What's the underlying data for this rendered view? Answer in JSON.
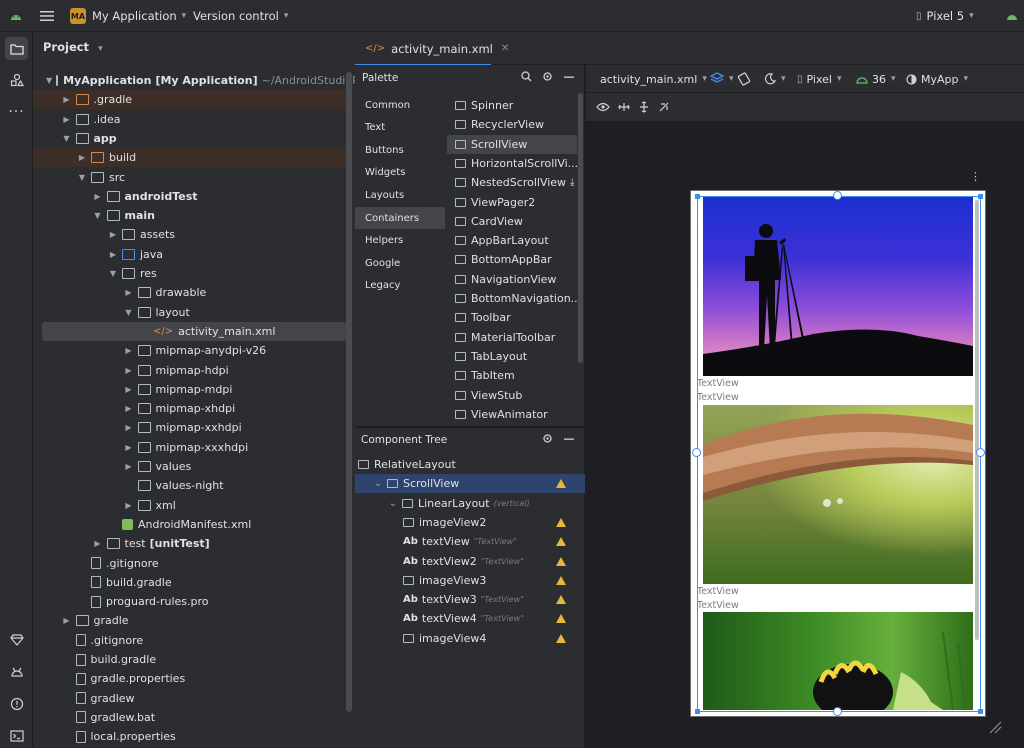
{
  "topbar": {
    "project_badge": "MA",
    "project_name": "My Application",
    "vcs": "Version control",
    "device": "Pixel 5"
  },
  "project_panel": {
    "title": "Project",
    "tree": [
      {
        "label": "MyApplication",
        "extra": "[My Application]",
        "path": "~/AndroidStudioProject",
        "indent": 0,
        "arrow": "open",
        "icon": "folder"
      },
      {
        "label": ".gradle",
        "indent": 1,
        "arrow": "closed",
        "icon": "folder-orange",
        "excluded": true
      },
      {
        "label": ".idea",
        "indent": 1,
        "arrow": "closed",
        "icon": "folder"
      },
      {
        "label": "app",
        "indent": 1,
        "arrow": "open",
        "icon": "folder",
        "bold": true
      },
      {
        "label": "build",
        "indent": 2,
        "arrow": "closed",
        "icon": "folder-orange",
        "excluded": true
      },
      {
        "label": "src",
        "indent": 2,
        "arrow": "open",
        "icon": "folder"
      },
      {
        "label": "androidTest",
        "indent": 3,
        "arrow": "closed",
        "icon": "folder",
        "bold": true
      },
      {
        "label": "main",
        "indent": 3,
        "arrow": "open",
        "icon": "folder",
        "bold": true
      },
      {
        "label": "assets",
        "indent": 4,
        "arrow": "closed",
        "icon": "folder"
      },
      {
        "label": "java",
        "indent": 4,
        "arrow": "closed",
        "icon": "folder-blue"
      },
      {
        "label": "res",
        "indent": 4,
        "arrow": "open",
        "icon": "folder"
      },
      {
        "label": "drawable",
        "indent": 5,
        "arrow": "closed",
        "icon": "folder"
      },
      {
        "label": "layout",
        "indent": 5,
        "arrow": "open",
        "icon": "folder"
      },
      {
        "label": "activity_main.xml",
        "indent": 6,
        "arrow": "none",
        "icon": "xml",
        "selected": true
      },
      {
        "label": "mipmap-anydpi-v26",
        "indent": 5,
        "arrow": "closed",
        "icon": "folder"
      },
      {
        "label": "mipmap-hdpi",
        "indent": 5,
        "arrow": "closed",
        "icon": "folder"
      },
      {
        "label": "mipmap-mdpi",
        "indent": 5,
        "arrow": "closed",
        "icon": "folder"
      },
      {
        "label": "mipmap-xhdpi",
        "indent": 5,
        "arrow": "closed",
        "icon": "folder"
      },
      {
        "label": "mipmap-xxhdpi",
        "indent": 5,
        "arrow": "closed",
        "icon": "folder"
      },
      {
        "label": "mipmap-xxxhdpi",
        "indent": 5,
        "arrow": "closed",
        "icon": "folder"
      },
      {
        "label": "values",
        "indent": 5,
        "arrow": "closed",
        "icon": "folder"
      },
      {
        "label": "values-night",
        "indent": 5,
        "arrow": "none",
        "icon": "folder"
      },
      {
        "label": "xml",
        "indent": 5,
        "arrow": "closed",
        "icon": "folder"
      },
      {
        "label": "AndroidManifest.xml",
        "indent": 4,
        "arrow": "none",
        "icon": "android"
      },
      {
        "label": "test",
        "extra": "[unitTest]",
        "indent": 3,
        "arrow": "closed",
        "icon": "folder"
      },
      {
        "label": ".gitignore",
        "indent": 2,
        "arrow": "none",
        "icon": "file"
      },
      {
        "label": "build.gradle",
        "indent": 2,
        "arrow": "none",
        "icon": "file"
      },
      {
        "label": "proguard-rules.pro",
        "indent": 2,
        "arrow": "none",
        "icon": "file"
      },
      {
        "label": "gradle",
        "indent": 1,
        "arrow": "closed",
        "icon": "folder"
      },
      {
        "label": ".gitignore",
        "indent": 1,
        "arrow": "none",
        "icon": "file"
      },
      {
        "label": "build.gradle",
        "indent": 1,
        "arrow": "none",
        "icon": "file"
      },
      {
        "label": "gradle.properties",
        "indent": 1,
        "arrow": "none",
        "icon": "file"
      },
      {
        "label": "gradlew",
        "indent": 1,
        "arrow": "none",
        "icon": "file"
      },
      {
        "label": "gradlew.bat",
        "indent": 1,
        "arrow": "none",
        "icon": "file"
      },
      {
        "label": "local.properties",
        "indent": 1,
        "arrow": "none",
        "icon": "file"
      }
    ]
  },
  "editor": {
    "tab": "activity_main.xml"
  },
  "palette": {
    "title": "Palette",
    "categories": [
      "Common",
      "Text",
      "Buttons",
      "Widgets",
      "Layouts",
      "Containers",
      "Helpers",
      "Google",
      "Legacy"
    ],
    "selected_category": "Containers",
    "widgets": [
      "Spinner",
      "RecyclerView",
      "ScrollView",
      "HorizontalScrollVi...",
      "NestedScrollView",
      "ViewPager2",
      "CardView",
      "AppBarLayout",
      "BottomAppBar",
      "NavigationView",
      "BottomNavigation...",
      "Toolbar",
      "MaterialToolbar",
      "TabLayout",
      "TabItem",
      "ViewStub",
      "ViewAnimator"
    ],
    "selected_widget": "ScrollView"
  },
  "component_tree": {
    "title": "Component Tree",
    "rows": [
      {
        "label": "RelativeLayout",
        "indent": 0,
        "warn": false
      },
      {
        "label": "ScrollView",
        "indent": 1,
        "warn": true,
        "selected": true,
        "arrow": "open"
      },
      {
        "label": "LinearLayout",
        "sub": "(vertical)",
        "indent": 2,
        "warn": false,
        "arrow": "open"
      },
      {
        "label": "imageView2",
        "indent": 3,
        "warn": true,
        "icon": "image"
      },
      {
        "label": "textView",
        "sub": "\"TextView\"",
        "indent": 3,
        "warn": true,
        "icon": "ab"
      },
      {
        "label": "textView2",
        "sub": "\"TextView\"",
        "indent": 3,
        "warn": true,
        "icon": "ab"
      },
      {
        "label": "imageView3",
        "indent": 3,
        "warn": true,
        "icon": "image"
      },
      {
        "label": "textView3",
        "sub": "\"TextView\"",
        "indent": 3,
        "warn": true,
        "icon": "ab"
      },
      {
        "label": "textView4",
        "sub": "\"TextView\"",
        "indent": 3,
        "warn": true,
        "icon": "ab"
      },
      {
        "label": "imageView4",
        "indent": 3,
        "warn": true,
        "icon": "image"
      }
    ]
  },
  "design_toolbar": {
    "file": "activity_main.xml",
    "device": "Pixel",
    "api": "36",
    "theme": "MyApp"
  },
  "device_preview": {
    "text_labels": [
      "TextView",
      "TextView",
      "TextView",
      "TextView"
    ]
  },
  "colors": {
    "accent": "#3d8cf0",
    "warning": "#e5b73b",
    "selection": "#2e436e"
  }
}
